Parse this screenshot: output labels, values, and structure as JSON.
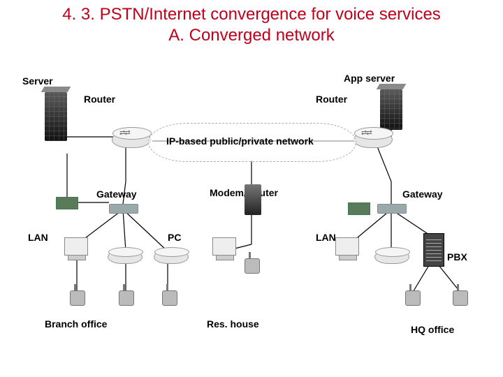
{
  "title": {
    "line1": "4. 3. PSTN/Internet convergence for voice services",
    "line2": "A. Converged network"
  },
  "labels": {
    "server": "Server",
    "app_server": "App server",
    "router_left": "Router",
    "router_right": "Router",
    "network": "IP-based public/private network",
    "gateway_left": "Gateway",
    "gateway_right": "Gateway",
    "modem_router": "Modem/Router",
    "lan_left": "LAN",
    "lan_right": "LAN",
    "pc": "PC",
    "pbx": "PBX",
    "branch_office": "Branch office",
    "res_house": "Res. house",
    "hq_office": "HQ office"
  }
}
